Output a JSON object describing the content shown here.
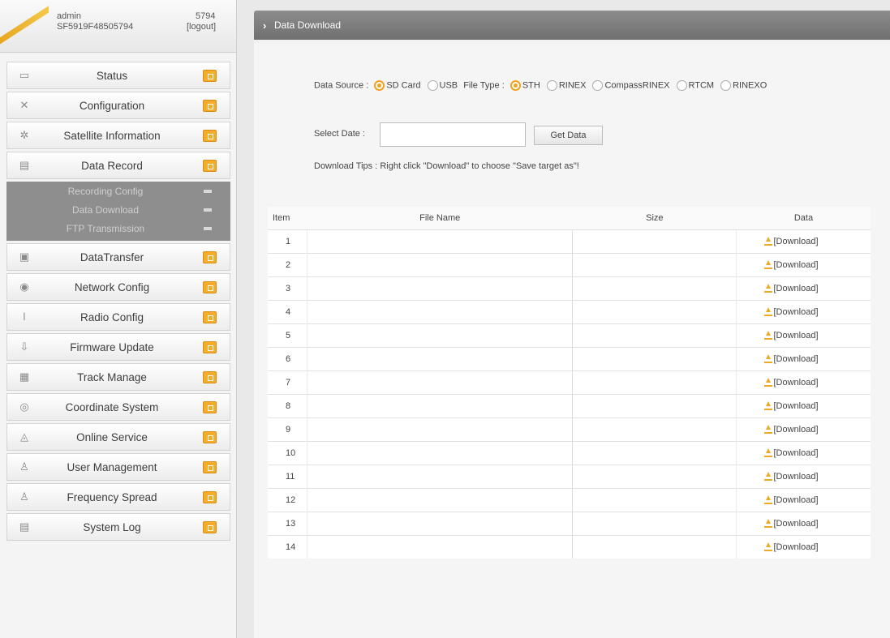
{
  "user": {
    "name": "admin",
    "serial": "SF5919F48505794",
    "code": "5794",
    "logout_label": "[logout]"
  },
  "sidebar": {
    "items": [
      {
        "label": "Status",
        "icon": "monitor-icon",
        "glyph": "▭"
      },
      {
        "label": "Configuration",
        "icon": "tools-icon",
        "glyph": "✕"
      },
      {
        "label": "Satellite Information",
        "icon": "satellite-icon",
        "glyph": "✲"
      },
      {
        "label": "Data Record",
        "icon": "record-icon",
        "glyph": "▤"
      },
      {
        "label": "DataTransfer",
        "icon": "transfer-icon",
        "glyph": "▣"
      },
      {
        "label": "Network Config",
        "icon": "network-icon",
        "glyph": "◉"
      },
      {
        "label": "Radio Config",
        "icon": "radio-icon",
        "glyph": "ǀ"
      },
      {
        "label": "Firmware Update",
        "icon": "update-icon",
        "glyph": "⇩"
      },
      {
        "label": "Track Manage",
        "icon": "track-icon",
        "glyph": "▦"
      },
      {
        "label": "Coordinate System",
        "icon": "coordinate-icon",
        "glyph": "◎"
      },
      {
        "label": "Online Service",
        "icon": "service-icon",
        "glyph": "◬"
      },
      {
        "label": "User Management",
        "icon": "user-icon",
        "glyph": "♙"
      },
      {
        "label": "Frequency Spread",
        "icon": "frequency-icon",
        "glyph": "♙"
      },
      {
        "label": "System Log",
        "icon": "log-icon",
        "glyph": "▤"
      }
    ],
    "submenu": [
      {
        "label": "Recording Config"
      },
      {
        "label": "Data Download"
      },
      {
        "label": "FTP Transmission"
      }
    ]
  },
  "page": {
    "title": "Data Download"
  },
  "form": {
    "data_source_label": "Data Source :",
    "sources": [
      {
        "label": "SD Card",
        "selected": true
      },
      {
        "label": "USB",
        "selected": false
      }
    ],
    "file_type_label": "File Type :",
    "file_types": [
      {
        "label": "STH",
        "selected": true
      },
      {
        "label": "RINEX",
        "selected": false
      },
      {
        "label": "CompassRINEX",
        "selected": false
      },
      {
        "label": "RTCM",
        "selected": false
      },
      {
        "label": "RINEXO",
        "selected": false
      }
    ],
    "select_date_label": "Select Date :",
    "date_value": "",
    "get_data_label": "Get Data",
    "tips": "Download Tips : Right click \"Download\" to choose \"Save target as\"!"
  },
  "table": {
    "columns": [
      "Item",
      "File Name",
      "Size",
      "Data"
    ],
    "download_label": "[Download]",
    "rows": [
      {
        "item": "1",
        "file": "",
        "size": ""
      },
      {
        "item": "2",
        "file": "",
        "size": ""
      },
      {
        "item": "3",
        "file": "",
        "size": ""
      },
      {
        "item": "4",
        "file": "",
        "size": ""
      },
      {
        "item": "5",
        "file": "",
        "size": ""
      },
      {
        "item": "6",
        "file": "",
        "size": ""
      },
      {
        "item": "7",
        "file": "",
        "size": ""
      },
      {
        "item": "8",
        "file": "",
        "size": ""
      },
      {
        "item": "9",
        "file": "",
        "size": ""
      },
      {
        "item": "10",
        "file": "",
        "size": ""
      },
      {
        "item": "11",
        "file": "",
        "size": ""
      },
      {
        "item": "12",
        "file": "",
        "size": ""
      },
      {
        "item": "13",
        "file": "",
        "size": ""
      },
      {
        "item": "14",
        "file": "",
        "size": ""
      }
    ]
  },
  "colors": {
    "accent": "#f0a21e",
    "title_bar": "#7a7a7a",
    "submenu_bg": "#8e8e8e"
  }
}
